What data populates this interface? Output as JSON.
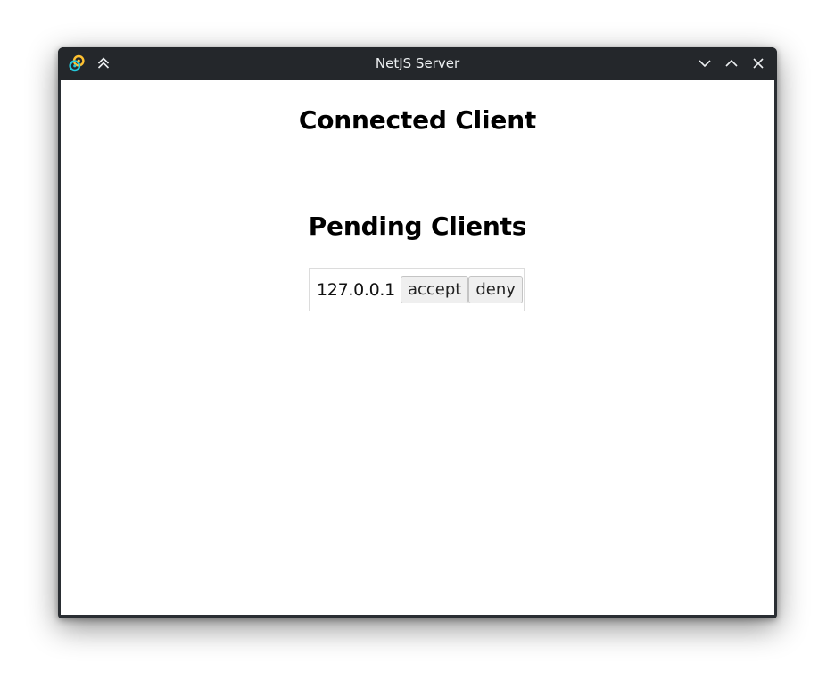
{
  "window": {
    "title": "NetJS Server",
    "app_icon": "tauri-logo-icon",
    "controls": {
      "keep_above_icon": "double-chevron-up-icon",
      "minimize_icon": "chevron-down-icon",
      "maximize_icon": "chevron-up-icon",
      "close_icon": "close-icon"
    }
  },
  "connected": {
    "heading": "Connected Client"
  },
  "pending": {
    "heading": "Pending Clients",
    "clients": [
      {
        "ip": "127.0.0.1",
        "accept_label": "accept",
        "deny_label": "deny"
      }
    ]
  },
  "colors": {
    "titlebar": "#24272b",
    "background": "#ffffff",
    "logo_blue": "#24c8db",
    "logo_orange": "#ffc131"
  }
}
